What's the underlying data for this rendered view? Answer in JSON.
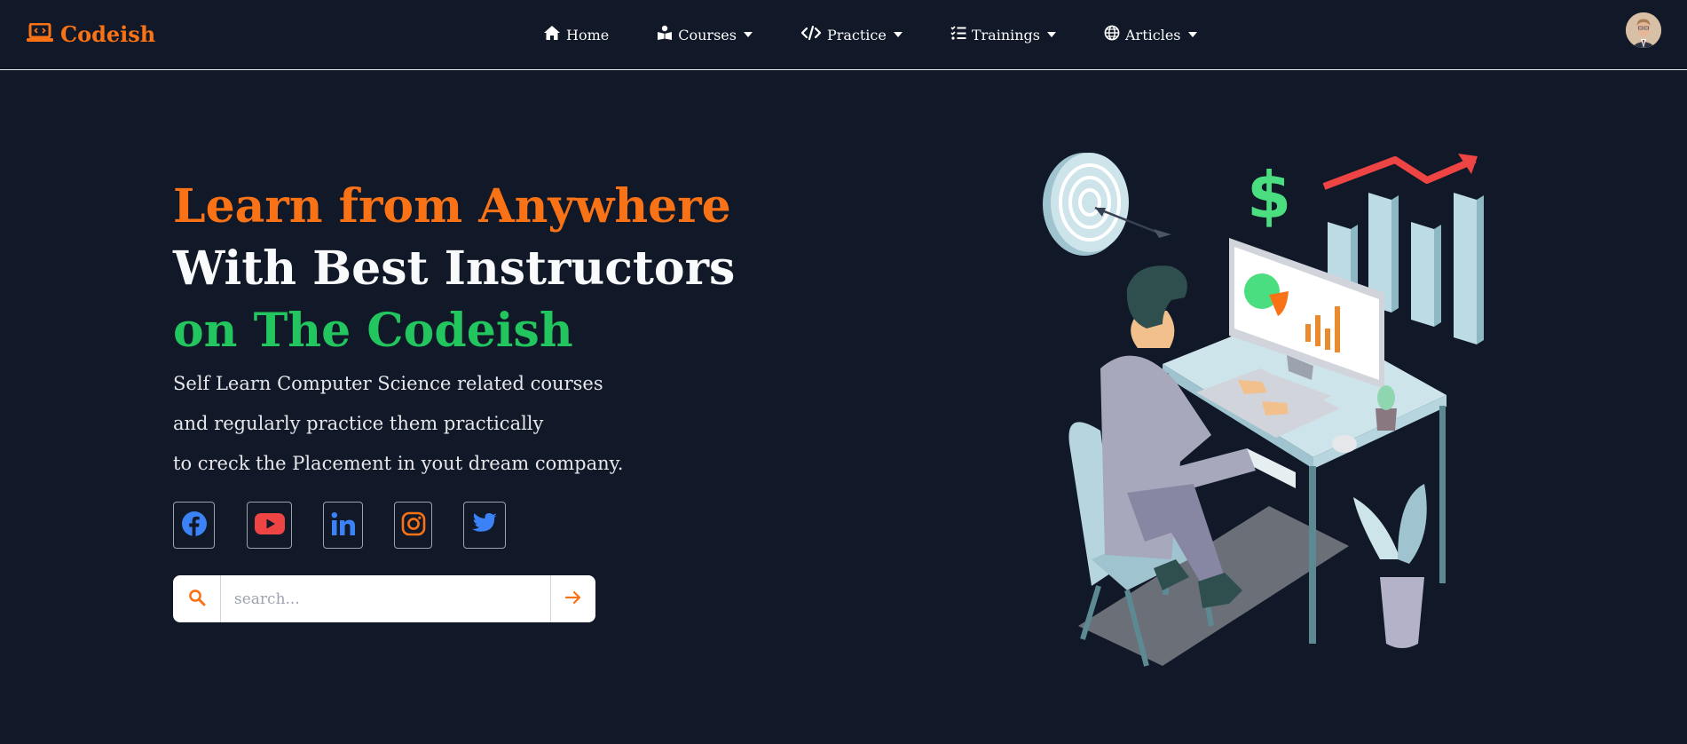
{
  "brand": {
    "name": "Codeish",
    "logo_icon": "laptop-code-icon",
    "color": "#f97316"
  },
  "nav": {
    "items": [
      {
        "label": "Home",
        "icon": "home-icon",
        "dropdown": false
      },
      {
        "label": "Courses",
        "icon": "book-reader-icon",
        "dropdown": true
      },
      {
        "label": "Practice",
        "icon": "code-icon",
        "dropdown": true
      },
      {
        "label": "Trainings",
        "icon": "checklist-icon",
        "dropdown": true
      },
      {
        "label": "Articles",
        "icon": "globe-icon",
        "dropdown": true
      }
    ]
  },
  "hero": {
    "title_line1": "Learn from Anywhere",
    "title_line2": "With Best Instructors",
    "title_line3": "on The Codeish",
    "desc_line1": "Self Learn Computer Science related courses",
    "desc_line2": "and regularly practice them practically",
    "desc_line3": "to creck the Placement in yout dream company."
  },
  "socials": [
    {
      "name": "facebook",
      "icon": "facebook-icon",
      "color": "#3b82f6"
    },
    {
      "name": "youtube",
      "icon": "youtube-icon",
      "color": "#ef4444"
    },
    {
      "name": "linkedin",
      "icon": "linkedin-icon",
      "color": "#3b82f6"
    },
    {
      "name": "instagram",
      "icon": "instagram-icon",
      "color": "#f97316"
    },
    {
      "name": "twitter",
      "icon": "twitter-icon",
      "color": "#3b82f6"
    }
  ],
  "search": {
    "placeholder": "search...",
    "value": "",
    "icon": "search-icon",
    "submit_icon": "arrow-right-icon"
  },
  "colors": {
    "background": "#111827",
    "accent_orange": "#f97316",
    "accent_green": "#22c55e"
  }
}
